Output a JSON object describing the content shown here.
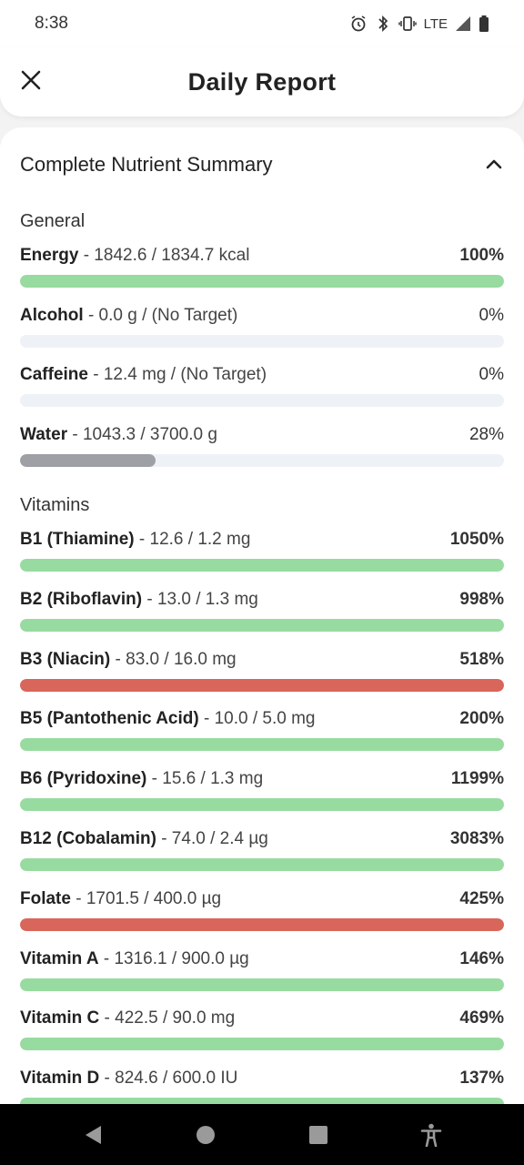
{
  "status": {
    "time": "8:38",
    "network": "LTE"
  },
  "header": {
    "title": "Daily Report"
  },
  "summary": {
    "title": "Complete Nutrient Summary"
  },
  "groups": [
    {
      "title": "General"
    },
    {
      "title": "Vitamins"
    }
  ],
  "colors": {
    "green": "#98dba0",
    "red": "#d9665a",
    "gray": "#9fa0a6",
    "track": "#eef1f6"
  },
  "rows": [
    {
      "name": "Energy",
      "values": " - 1842.6 / 1834.7 kcal",
      "pct": "100%",
      "level": 1.0,
      "color": "green",
      "bold": true
    },
    {
      "name": "Alcohol",
      "values": " - 0.0 g / (No Target)",
      "pct": "0%",
      "level": 0.0,
      "color": "gray",
      "bold": false
    },
    {
      "name": "Caffeine",
      "values": " - 12.4 mg / (No Target)",
      "pct": "0%",
      "level": 0.0,
      "color": "gray",
      "bold": false
    },
    {
      "name": "Water",
      "values": " - 1043.3 / 3700.0 g",
      "pct": "28%",
      "level": 0.28,
      "color": "gray",
      "bold": false
    },
    {
      "name": "B1 (Thiamine)",
      "values": " - 12.6 / 1.2 mg",
      "pct": "1050%",
      "level": 1.0,
      "color": "green",
      "bold": true
    },
    {
      "name": "B2 (Riboflavin)",
      "values": " - 13.0 / 1.3 mg",
      "pct": "998%",
      "level": 1.0,
      "color": "green",
      "bold": true
    },
    {
      "name": "B3 (Niacin)",
      "values": " - 83.0 / 16.0 mg",
      "pct": "518%",
      "level": 1.0,
      "color": "red",
      "bold": true
    },
    {
      "name": "B5 (Pantothenic Acid)",
      "values": " - 10.0 / 5.0 mg",
      "pct": "200%",
      "level": 1.0,
      "color": "green",
      "bold": true
    },
    {
      "name": "B6 (Pyridoxine)",
      "values": " - 15.6 / 1.3 mg",
      "pct": "1199%",
      "level": 1.0,
      "color": "green",
      "bold": true
    },
    {
      "name": "B12 (Cobalamin)",
      "values": " - 74.0 / 2.4 µg",
      "pct": "3083%",
      "level": 1.0,
      "color": "green",
      "bold": true
    },
    {
      "name": "Folate",
      "values": " - 1701.5 / 400.0 µg",
      "pct": "425%",
      "level": 1.0,
      "color": "red",
      "bold": true
    },
    {
      "name": "Vitamin A",
      "values": " - 1316.1 / 900.0 µg",
      "pct": "146%",
      "level": 1.0,
      "color": "green",
      "bold": true
    },
    {
      "name": "Vitamin C",
      "values": " - 422.5 / 90.0 mg",
      "pct": "469%",
      "level": 1.0,
      "color": "green",
      "bold": true
    },
    {
      "name": "Vitamin D",
      "values": " - 824.6 / 600.0 IU",
      "pct": "137%",
      "level": 1.0,
      "color": "green",
      "bold": true
    }
  ],
  "nav": [
    "back-icon",
    "home-icon",
    "recents-icon",
    "accessibility-icon"
  ]
}
